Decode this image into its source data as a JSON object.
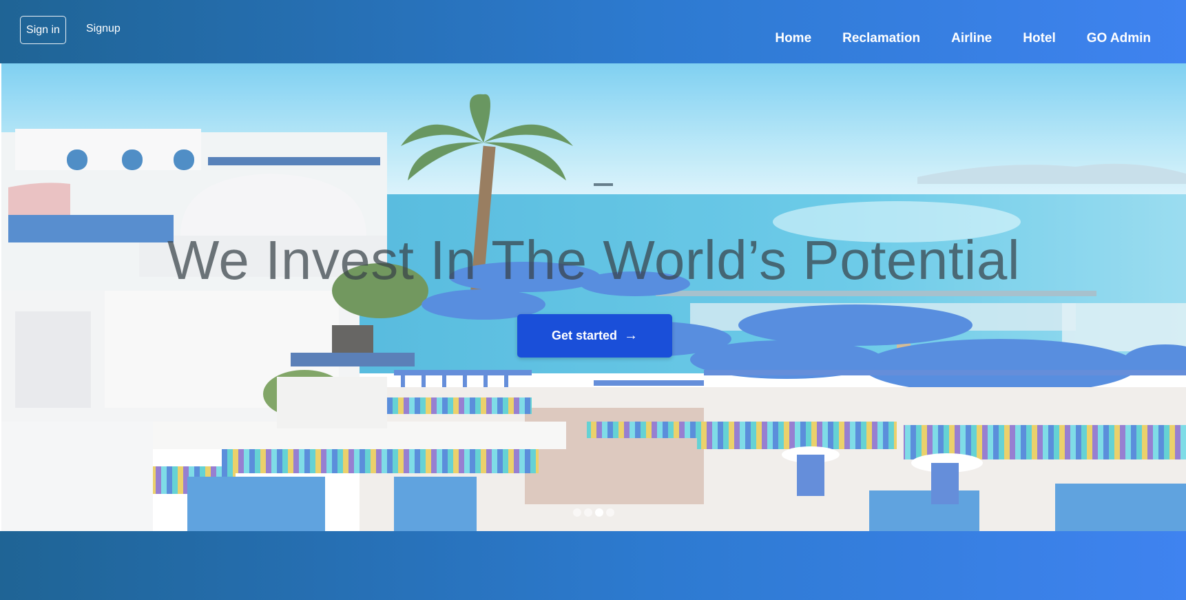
{
  "auth": {
    "signin_label": "Sign in",
    "signup_label": "Signup"
  },
  "nav": {
    "items": [
      {
        "label": "Home"
      },
      {
        "label": "Reclamation"
      },
      {
        "label": "Airline"
      },
      {
        "label": "Hotel"
      },
      {
        "label": "GO Admin"
      }
    ]
  },
  "hero": {
    "title": "We Invest In The World’s Potential",
    "cta_label": "Get started",
    "cta_icon": "arrow-right-icon",
    "carousel": {
      "slide_count": 4,
      "active_index": 2
    }
  },
  "colors": {
    "header_gradient_start": "#1f6495",
    "header_gradient_end": "#3f83f0",
    "cta_background": "#1a4fd9"
  }
}
